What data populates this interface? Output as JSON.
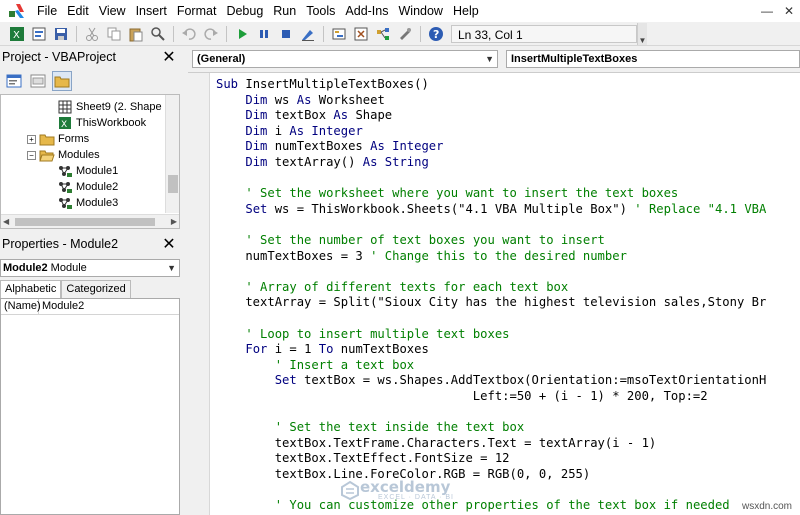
{
  "menubar": {
    "items": [
      "File",
      "Edit",
      "View",
      "Insert",
      "Format",
      "Debug",
      "Run",
      "Tools",
      "Add-Ins",
      "Window",
      "Help"
    ],
    "icon": "vba-app-icon"
  },
  "toolbar": {
    "position_text": "Ln 33, Col 1"
  },
  "project_panel": {
    "title": "Project - VBAProject",
    "tree": [
      {
        "label": "Sheet9 (2. Shape S",
        "icon": "sheet-icon",
        "indent": 3
      },
      {
        "label": "ThisWorkbook",
        "icon": "workbook-icon",
        "indent": 3
      },
      {
        "label": "Forms",
        "icon": "folder-icon",
        "indent": 2,
        "expander": "+"
      },
      {
        "label": "Modules",
        "icon": "folder-open-icon",
        "indent": 2,
        "expander": "−"
      },
      {
        "label": "Module1",
        "icon": "module-icon",
        "indent": 3
      },
      {
        "label": "Module2",
        "icon": "module-icon",
        "indent": 3
      },
      {
        "label": "Module3",
        "icon": "module-icon",
        "indent": 3
      }
    ]
  },
  "properties_panel": {
    "title": "Properties - Module2",
    "object_select_bold": "Module2",
    "object_select_rest": " Module",
    "tabs": [
      "Alphabetic",
      "Categorized"
    ],
    "rows": [
      {
        "key": "(Name)",
        "value": "Module2"
      }
    ]
  },
  "code_window": {
    "object_combo": "(General)",
    "proc_combo": "InsertMultipleTextBoxes",
    "lines": [
      [
        {
          "t": "Sub ",
          "c": "kw"
        },
        {
          "t": "InsertMultipleTextBoxes()"
        }
      ],
      [
        {
          "t": "    "
        },
        {
          "t": "Dim ",
          "c": "kw"
        },
        {
          "t": "ws "
        },
        {
          "t": "As ",
          "c": "kw"
        },
        {
          "t": "Worksheet"
        }
      ],
      [
        {
          "t": "    "
        },
        {
          "t": "Dim ",
          "c": "kw"
        },
        {
          "t": "textBox "
        },
        {
          "t": "As ",
          "c": "kw"
        },
        {
          "t": "Shape"
        }
      ],
      [
        {
          "t": "    "
        },
        {
          "t": "Dim ",
          "c": "kw"
        },
        {
          "t": "i "
        },
        {
          "t": "As Integer",
          "c": "kw"
        }
      ],
      [
        {
          "t": "    "
        },
        {
          "t": "Dim ",
          "c": "kw"
        },
        {
          "t": "numTextBoxes "
        },
        {
          "t": "As Integer",
          "c": "kw"
        }
      ],
      [
        {
          "t": "    "
        },
        {
          "t": "Dim ",
          "c": "kw"
        },
        {
          "t": "textArray() "
        },
        {
          "t": "As String",
          "c": "kw"
        }
      ],
      [
        {
          "t": ""
        }
      ],
      [
        {
          "t": "    "
        },
        {
          "t": "' Set the worksheet where you want to insert the text boxes",
          "c": "cm"
        }
      ],
      [
        {
          "t": "    "
        },
        {
          "t": "Set ",
          "c": "kw"
        },
        {
          "t": "ws = ThisWorkbook.Sheets(\"4.1 VBA Multiple Box\") "
        },
        {
          "t": "' Replace \"4.1 VBA",
          "c": "cm"
        }
      ],
      [
        {
          "t": ""
        }
      ],
      [
        {
          "t": "    "
        },
        {
          "t": "' Set the number of text boxes you want to insert",
          "c": "cm"
        }
      ],
      [
        {
          "t": "    numTextBoxes = 3 "
        },
        {
          "t": "' Change this to the desired number",
          "c": "cm"
        }
      ],
      [
        {
          "t": ""
        }
      ],
      [
        {
          "t": "    "
        },
        {
          "t": "' Array of different texts for each text box",
          "c": "cm"
        }
      ],
      [
        {
          "t": "    textArray = Split(\"Sioux City has the highest television sales,Stony Br"
        }
      ],
      [
        {
          "t": ""
        }
      ],
      [
        {
          "t": "    "
        },
        {
          "t": "' Loop to insert multiple text boxes",
          "c": "cm"
        }
      ],
      [
        {
          "t": "    "
        },
        {
          "t": "For ",
          "c": "kw"
        },
        {
          "t": "i = 1 "
        },
        {
          "t": "To ",
          "c": "kw"
        },
        {
          "t": "numTextBoxes"
        }
      ],
      [
        {
          "t": "        "
        },
        {
          "t": "' Insert a text box",
          "c": "cm"
        }
      ],
      [
        {
          "t": "        "
        },
        {
          "t": "Set ",
          "c": "kw"
        },
        {
          "t": "textBox = ws.Shapes.AddTextbox(Orientation:=msoTextOrientationH"
        }
      ],
      [
        {
          "t": "                                   Left:=50 + (i - 1) * 200, Top:=2"
        }
      ],
      [
        {
          "t": ""
        }
      ],
      [
        {
          "t": "        "
        },
        {
          "t": "' Set the text inside the text box",
          "c": "cm"
        }
      ],
      [
        {
          "t": "        textBox.TextFrame.Characters.Text = textArray(i - 1)"
        }
      ],
      [
        {
          "t": "        textBox.TextEffect.FontSize = 12"
        }
      ],
      [
        {
          "t": "        textBox.Line.ForeColor.RGB = RGB(0, 0, 255)"
        }
      ],
      [
        {
          "t": ""
        }
      ],
      [
        {
          "t": "        "
        },
        {
          "t": "' You can customize other properties of the text box if needed",
          "c": "cm"
        }
      ]
    ]
  },
  "watermark": {
    "name": "exceldemy",
    "tagline": "EXCEL · DATA · BI"
  },
  "site_tag": "wsxdn.com",
  "colors": {
    "keyword": "#00007f",
    "comment": "#007f00"
  }
}
